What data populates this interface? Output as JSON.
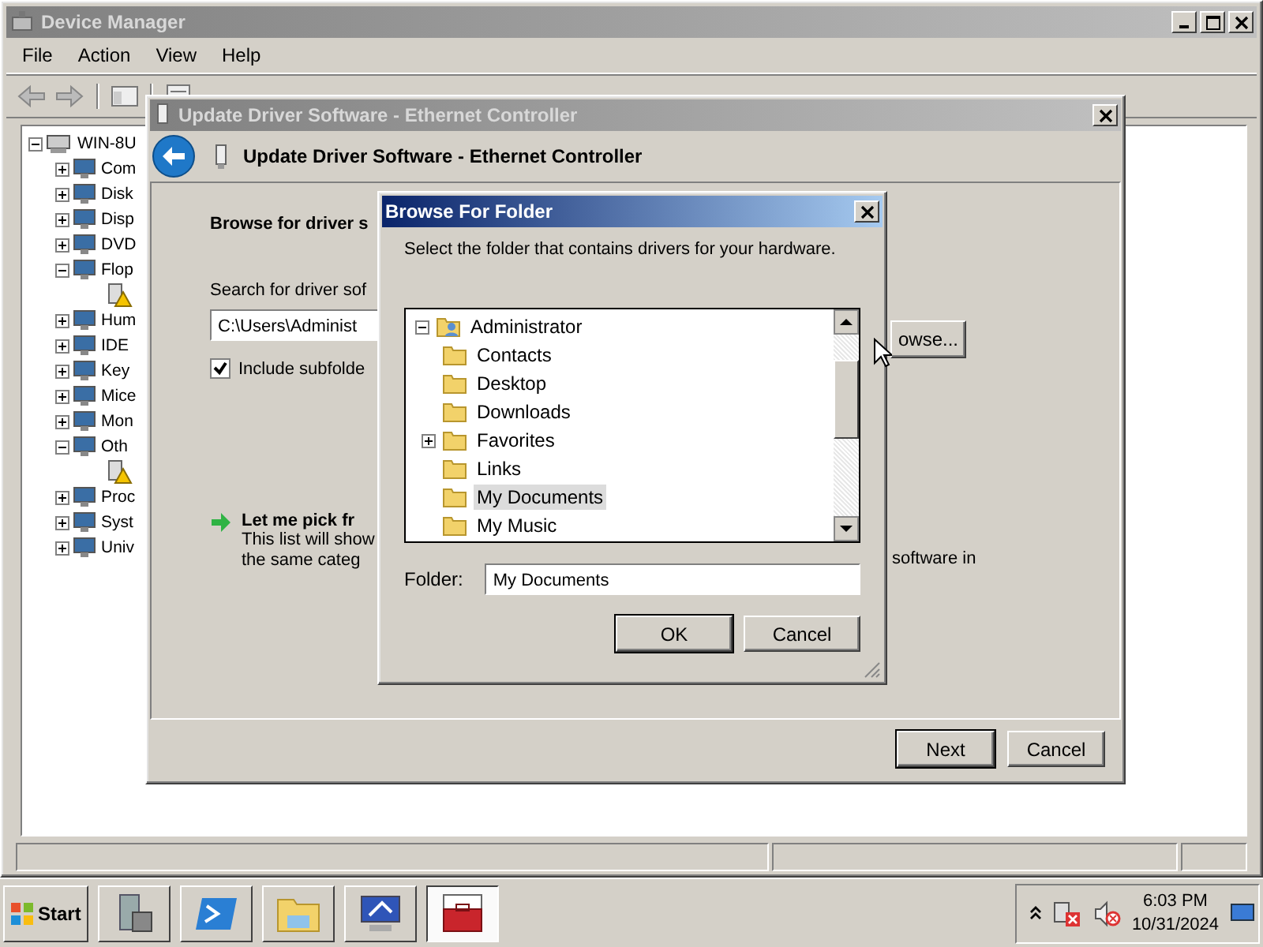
{
  "device_manager": {
    "title": "Device Manager",
    "menu": [
      "File",
      "Action",
      "View",
      "Help"
    ],
    "tree": {
      "label": "WIN-8U",
      "expanded": true,
      "children": [
        {
          "label": "Com",
          "expanded": false
        },
        {
          "label": "Disk",
          "expanded": false
        },
        {
          "label": "Disp",
          "expanded": false
        },
        {
          "label": "DVD",
          "expanded": false
        },
        {
          "label": "Flop",
          "expanded": true,
          "children": [
            {
              "kind": "warning-device"
            }
          ]
        },
        {
          "label": "Hum",
          "expanded": false
        },
        {
          "label": "IDE",
          "expanded": false
        },
        {
          "label": "Key",
          "expanded": false
        },
        {
          "label": "Mice",
          "expanded": false
        },
        {
          "label": "Mon",
          "expanded": false
        },
        {
          "label": "Oth",
          "expanded": true,
          "children": [
            {
              "kind": "warning-device"
            }
          ]
        },
        {
          "label": "Proc",
          "expanded": false
        },
        {
          "label": "Syst",
          "expanded": false
        },
        {
          "label": "Univ",
          "expanded": false
        }
      ]
    }
  },
  "update_driver": {
    "title": "Update Driver Software - Ethernet Controller",
    "header": "Update Driver Software - Ethernet Controller",
    "heading": "Browse for driver s",
    "search_label": "Search for driver sof",
    "path_field": {
      "value": "C:\\Users\\Administ"
    },
    "include_subfolders": {
      "label": "Include subfolde",
      "checked": true
    },
    "browse_button": "owse...",
    "pick_option": {
      "title": "Let me pick fr",
      "description": [
        "This list will show",
        "the same categ"
      ],
      "description_tail": "software in"
    },
    "buttons": [
      {
        "label": "Next",
        "default": true
      },
      {
        "label": "Cancel",
        "default": false
      }
    ]
  },
  "browse_folder": {
    "title": "Browse For Folder",
    "instruction": "Select the folder that contains drivers for your hardware.",
    "tree": {
      "label": "Administrator",
      "expanded": true,
      "children": [
        {
          "label": "Contacts",
          "selected": false
        },
        {
          "label": "Desktop",
          "selected": false
        },
        {
          "label": "Downloads",
          "selected": false
        },
        {
          "label": "Favorites",
          "expanded": false,
          "selected": false
        },
        {
          "label": "Links",
          "selected": false
        },
        {
          "label": "My Documents",
          "selected": true
        },
        {
          "label": "My Music",
          "selected": false
        }
      ]
    },
    "folder_label": "Folder:",
    "folder_field": {
      "value": "My Documents"
    },
    "buttons": [
      {
        "label": "OK",
        "default": true
      },
      {
        "label": "Cancel",
        "default": false
      }
    ]
  },
  "taskbar": {
    "start": "Start",
    "apps": [
      {
        "kind": "server",
        "selected": false
      },
      {
        "kind": "powershell",
        "selected": false
      },
      {
        "kind": "explorer",
        "selected": false
      },
      {
        "kind": "network",
        "selected": false
      },
      {
        "kind": "toolbox",
        "selected": true
      }
    ],
    "clock": {
      "time": "6:03 PM",
      "date": "10/31/2024"
    }
  }
}
